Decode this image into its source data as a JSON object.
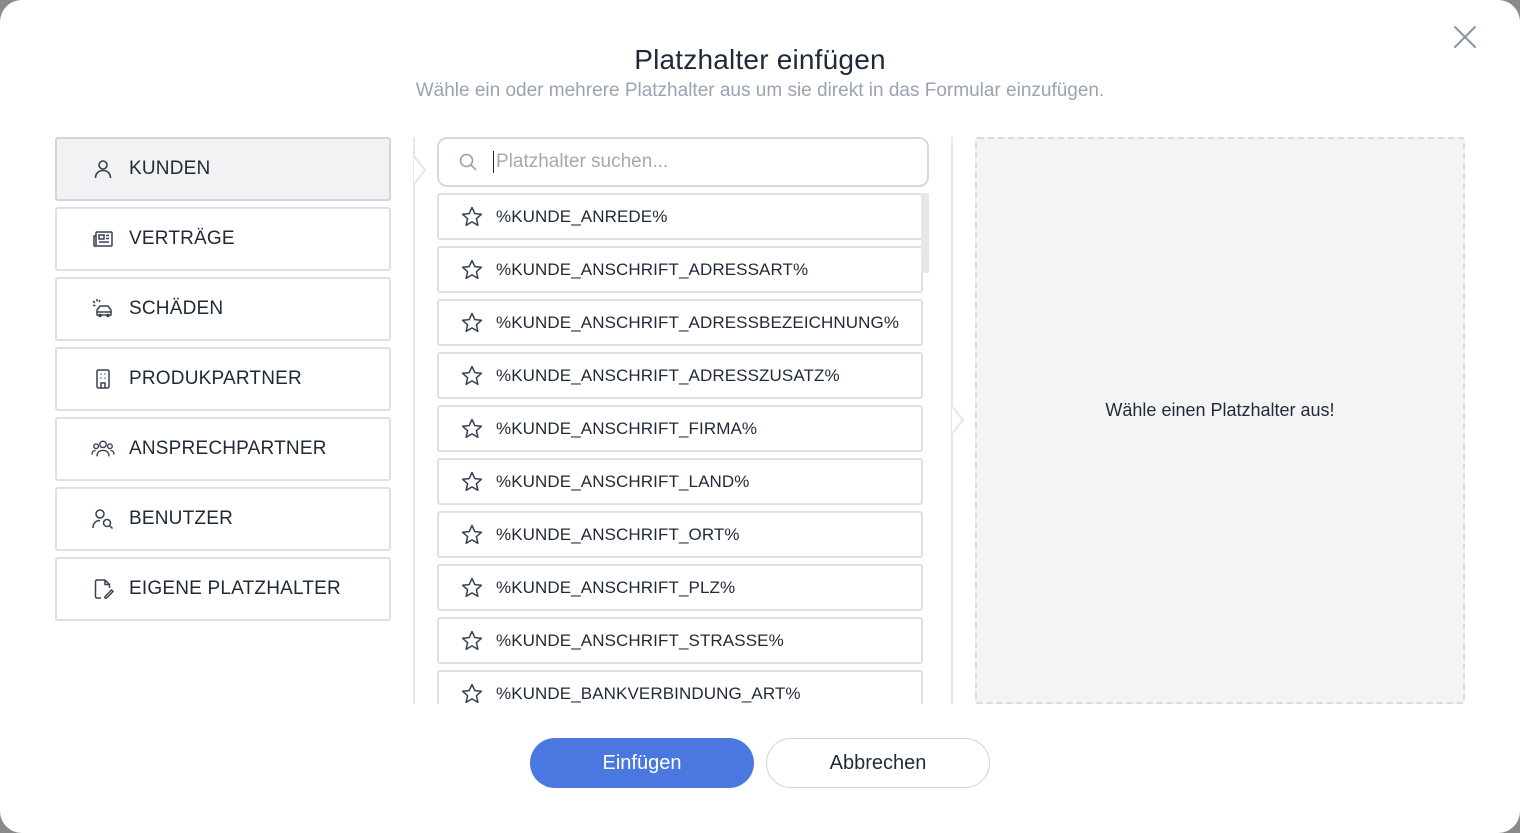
{
  "dialog": {
    "title": "Platzhalter einfügen",
    "subtitle": "Wähle ein oder mehrere Platzhalter aus um sie direkt in das Formular einzufügen."
  },
  "categories": [
    {
      "label": "KUNDEN",
      "icon": "person-icon",
      "active": true
    },
    {
      "label": "VERTRÄGE",
      "icon": "newspaper-icon",
      "active": false
    },
    {
      "label": "SCHÄDEN",
      "icon": "car-damage-icon",
      "active": false
    },
    {
      "label": "PRODUKPARTNER",
      "icon": "building-icon",
      "active": false
    },
    {
      "label": "ANSPRECHPARTNER",
      "icon": "group-icon",
      "active": false
    },
    {
      "label": "BENUTZER",
      "icon": "user-search-icon",
      "active": false
    },
    {
      "label": "EIGENE PLATZHALTER",
      "icon": "file-edit-icon",
      "active": false
    }
  ],
  "search": {
    "placeholder": "Platzhalter suchen...",
    "value": ""
  },
  "placeholders": [
    "%KUNDE_ANREDE%",
    "%KUNDE_ANSCHRIFT_ADRESSART%",
    "%KUNDE_ANSCHRIFT_ADRESSBEZEICHNUNG%",
    "%KUNDE_ANSCHRIFT_ADRESSZUSATZ%",
    "%KUNDE_ANSCHRIFT_FIRMA%",
    "%KUNDE_ANSCHRIFT_LAND%",
    "%KUNDE_ANSCHRIFT_ORT%",
    "%KUNDE_ANSCHRIFT_PLZ%",
    "%KUNDE_ANSCHRIFT_STRASSE%",
    "%KUNDE_BANKVERBINDUNG_ART%"
  ],
  "preview": {
    "empty_text": "Wähle einen Platzhalter aus!"
  },
  "buttons": {
    "insert": "Einfügen",
    "cancel": "Abbrechen"
  },
  "colors": {
    "primary": "#4a78e0",
    "preview_bg": "#f4f4f5"
  }
}
